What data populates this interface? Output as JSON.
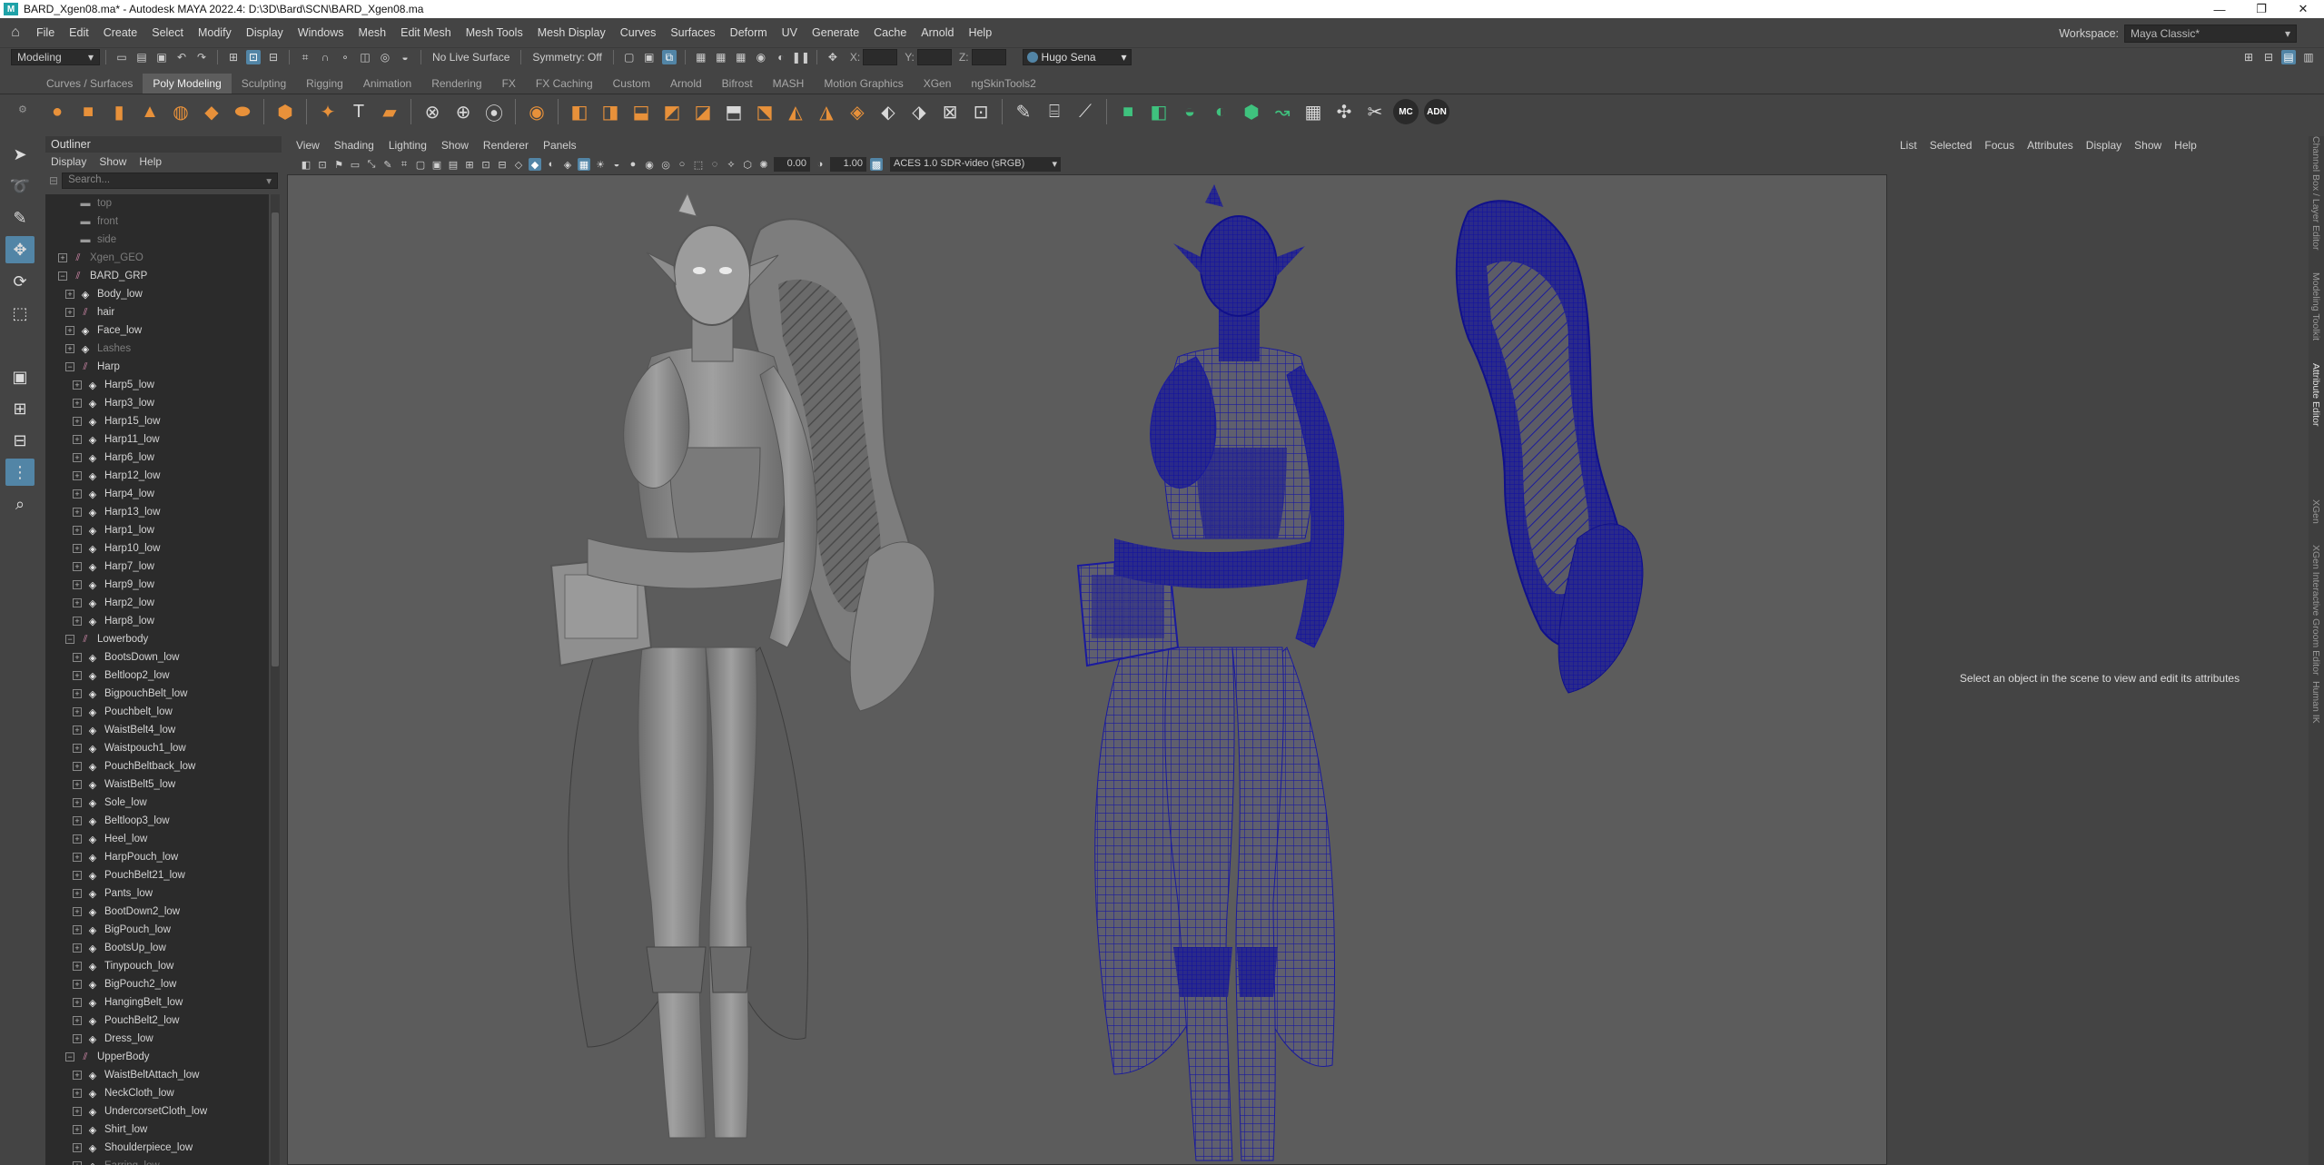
{
  "window": {
    "title": "BARD_Xgen08.ma* - Autodesk MAYA 2022.4: D:\\3D\\Bard\\SCN\\BARD_Xgen08.ma",
    "controls": [
      "—",
      "❐",
      "✕"
    ]
  },
  "menubar": {
    "items": [
      "File",
      "Edit",
      "Create",
      "Select",
      "Modify",
      "Display",
      "Windows",
      "Mesh",
      "Edit Mesh",
      "Mesh Tools",
      "Mesh Display",
      "Curves",
      "Surfaces",
      "Deform",
      "UV",
      "Generate",
      "Cache",
      "Arnold",
      "Help"
    ],
    "workspace_label": "Workspace:",
    "workspace_value": "Maya Classic*"
  },
  "statusline": {
    "menuset": "Modeling",
    "live_surface": "No Live Surface",
    "symmetry": "Symmetry: Off",
    "coord_x": "X:",
    "coord_y": "Y:",
    "coord_z": "Z:",
    "user": "Hugo Sena"
  },
  "shelf": {
    "tabs": [
      "Curves / Surfaces",
      "Poly Modeling",
      "Sculpting",
      "Rigging",
      "Animation",
      "Rendering",
      "FX",
      "FX Caching",
      "Custom",
      "Arnold",
      "Bifrost",
      "MASH",
      "Motion Graphics",
      "XGen",
      "ngSkinTools2"
    ],
    "active_tab": 1,
    "badges": [
      "MC",
      "ADN"
    ]
  },
  "outliner": {
    "title": "Outliner",
    "menu": [
      "Display",
      "Show",
      "Help"
    ],
    "search_placeholder": "Search...",
    "rows": [
      {
        "label": "top",
        "indent": 1,
        "type": "cam",
        "expand": "",
        "dim": true
      },
      {
        "label": "front",
        "indent": 1,
        "type": "cam",
        "expand": "",
        "dim": true
      },
      {
        "label": "side",
        "indent": 1,
        "type": "cam",
        "expand": "",
        "dim": true
      },
      {
        "label": "Xgen_GEO",
        "indent": 0,
        "type": "group",
        "expand": "+",
        "dim": true
      },
      {
        "label": "BARD_GRP",
        "indent": 0,
        "type": "group",
        "expand": "−",
        "dim": false
      },
      {
        "label": "Body_low",
        "indent": 1,
        "type": "mesh",
        "expand": "+",
        "dim": false
      },
      {
        "label": "hair",
        "indent": 1,
        "type": "group",
        "expand": "+",
        "dim": false
      },
      {
        "label": "Face_low",
        "indent": 1,
        "type": "mesh",
        "expand": "+",
        "dim": false
      },
      {
        "label": "Lashes",
        "indent": 1,
        "type": "mesh",
        "expand": "+",
        "dim": true
      },
      {
        "label": "Harp",
        "indent": 1,
        "type": "group",
        "expand": "−",
        "dim": false
      },
      {
        "label": "Harp5_low",
        "indent": 2,
        "type": "mesh",
        "expand": "+",
        "dim": false
      },
      {
        "label": "Harp3_low",
        "indent": 2,
        "type": "mesh",
        "expand": "+",
        "dim": false
      },
      {
        "label": "Harp15_low",
        "indent": 2,
        "type": "mesh",
        "expand": "+",
        "dim": false
      },
      {
        "label": "Harp11_low",
        "indent": 2,
        "type": "mesh",
        "expand": "+",
        "dim": false
      },
      {
        "label": "Harp6_low",
        "indent": 2,
        "type": "mesh",
        "expand": "+",
        "dim": false
      },
      {
        "label": "Harp12_low",
        "indent": 2,
        "type": "mesh",
        "expand": "+",
        "dim": false
      },
      {
        "label": "Harp4_low",
        "indent": 2,
        "type": "mesh",
        "expand": "+",
        "dim": false
      },
      {
        "label": "Harp13_low",
        "indent": 2,
        "type": "mesh",
        "expand": "+",
        "dim": false
      },
      {
        "label": "Harp1_low",
        "indent": 2,
        "type": "mesh",
        "expand": "+",
        "dim": false
      },
      {
        "label": "Harp10_low",
        "indent": 2,
        "type": "mesh",
        "expand": "+",
        "dim": false
      },
      {
        "label": "Harp7_low",
        "indent": 2,
        "type": "mesh",
        "expand": "+",
        "dim": false
      },
      {
        "label": "Harp9_low",
        "indent": 2,
        "type": "mesh",
        "expand": "+",
        "dim": false
      },
      {
        "label": "Harp2_low",
        "indent": 2,
        "type": "mesh",
        "expand": "+",
        "dim": false
      },
      {
        "label": "Harp8_low",
        "indent": 2,
        "type": "mesh",
        "expand": "+",
        "dim": false
      },
      {
        "label": "Lowerbody",
        "indent": 1,
        "type": "group",
        "expand": "−",
        "dim": false
      },
      {
        "label": "BootsDown_low",
        "indent": 2,
        "type": "mesh",
        "expand": "+",
        "dim": false
      },
      {
        "label": "Beltloop2_low",
        "indent": 2,
        "type": "mesh",
        "expand": "+",
        "dim": false
      },
      {
        "label": "BigpouchBelt_low",
        "indent": 2,
        "type": "mesh",
        "expand": "+",
        "dim": false
      },
      {
        "label": "Pouchbelt_low",
        "indent": 2,
        "type": "mesh",
        "expand": "+",
        "dim": false
      },
      {
        "label": "WaistBelt4_low",
        "indent": 2,
        "type": "mesh",
        "expand": "+",
        "dim": false
      },
      {
        "label": "Waistpouch1_low",
        "indent": 2,
        "type": "mesh",
        "expand": "+",
        "dim": false
      },
      {
        "label": "PouchBeltback_low",
        "indent": 2,
        "type": "mesh",
        "expand": "+",
        "dim": false
      },
      {
        "label": "WaistBelt5_low",
        "indent": 2,
        "type": "mesh",
        "expand": "+",
        "dim": false
      },
      {
        "label": "Sole_low",
        "indent": 2,
        "type": "mesh",
        "expand": "+",
        "dim": false
      },
      {
        "label": "Beltloop3_low",
        "indent": 2,
        "type": "mesh",
        "expand": "+",
        "dim": false
      },
      {
        "label": "Heel_low",
        "indent": 2,
        "type": "mesh",
        "expand": "+",
        "dim": false
      },
      {
        "label": "HarpPouch_low",
        "indent": 2,
        "type": "mesh",
        "expand": "+",
        "dim": false
      },
      {
        "label": "PouchBelt21_low",
        "indent": 2,
        "type": "mesh",
        "expand": "+",
        "dim": false
      },
      {
        "label": "Pants_low",
        "indent": 2,
        "type": "mesh",
        "expand": "+",
        "dim": false
      },
      {
        "label": "BootDown2_low",
        "indent": 2,
        "type": "mesh",
        "expand": "+",
        "dim": false
      },
      {
        "label": "BigPouch_low",
        "indent": 2,
        "type": "mesh",
        "expand": "+",
        "dim": false
      },
      {
        "label": "BootsUp_low",
        "indent": 2,
        "type": "mesh",
        "expand": "+",
        "dim": false
      },
      {
        "label": "Tinypouch_low",
        "indent": 2,
        "type": "mesh",
        "expand": "+",
        "dim": false
      },
      {
        "label": "BigPouch2_low",
        "indent": 2,
        "type": "mesh",
        "expand": "+",
        "dim": false
      },
      {
        "label": "HangingBelt_low",
        "indent": 2,
        "type": "mesh",
        "expand": "+",
        "dim": false
      },
      {
        "label": "PouchBelt2_low",
        "indent": 2,
        "type": "mesh",
        "expand": "+",
        "dim": false
      },
      {
        "label": "Dress_low",
        "indent": 2,
        "type": "mesh",
        "expand": "+",
        "dim": false
      },
      {
        "label": "UpperBody",
        "indent": 1,
        "type": "group",
        "expand": "−",
        "dim": false
      },
      {
        "label": "WaistBeltAttach_low",
        "indent": 2,
        "type": "mesh",
        "expand": "+",
        "dim": false
      },
      {
        "label": "NeckCloth_low",
        "indent": 2,
        "type": "mesh",
        "expand": "+",
        "dim": false
      },
      {
        "label": "UndercorsetCloth_low",
        "indent": 2,
        "type": "mesh",
        "expand": "+",
        "dim": false
      },
      {
        "label": "Shirt_low",
        "indent": 2,
        "type": "mesh",
        "expand": "+",
        "dim": false
      },
      {
        "label": "Shoulderpiece_low",
        "indent": 2,
        "type": "mesh",
        "expand": "+",
        "dim": false
      },
      {
        "label": "Earring_low",
        "indent": 2,
        "type": "mesh",
        "expand": "+",
        "dim": true
      }
    ]
  },
  "viewport": {
    "menu": [
      "View",
      "Shading",
      "Lighting",
      "Show",
      "Renderer",
      "Panels"
    ],
    "exposure": "0.00",
    "gamma": "1.00",
    "colorspace": "ACES 1.0 SDR-video (sRGB)",
    "wire_color": "#1a1a9e",
    "shaded_color": "#8a8a8a",
    "background_color": "#5c5c5c"
  },
  "attribute_editor": {
    "menu": [
      "List",
      "Selected",
      "Focus",
      "Attributes",
      "Display",
      "Show",
      "Help"
    ],
    "message": "Select an object in the scene to view and edit its attributes"
  },
  "side_tabs": [
    "Channel Box / Layer Editor",
    "Modeling Toolkit",
    "Attribute Editor",
    "XGen",
    "XGen Interactive Groom Editor",
    "Human IK"
  ],
  "side_tab_active": 2
}
